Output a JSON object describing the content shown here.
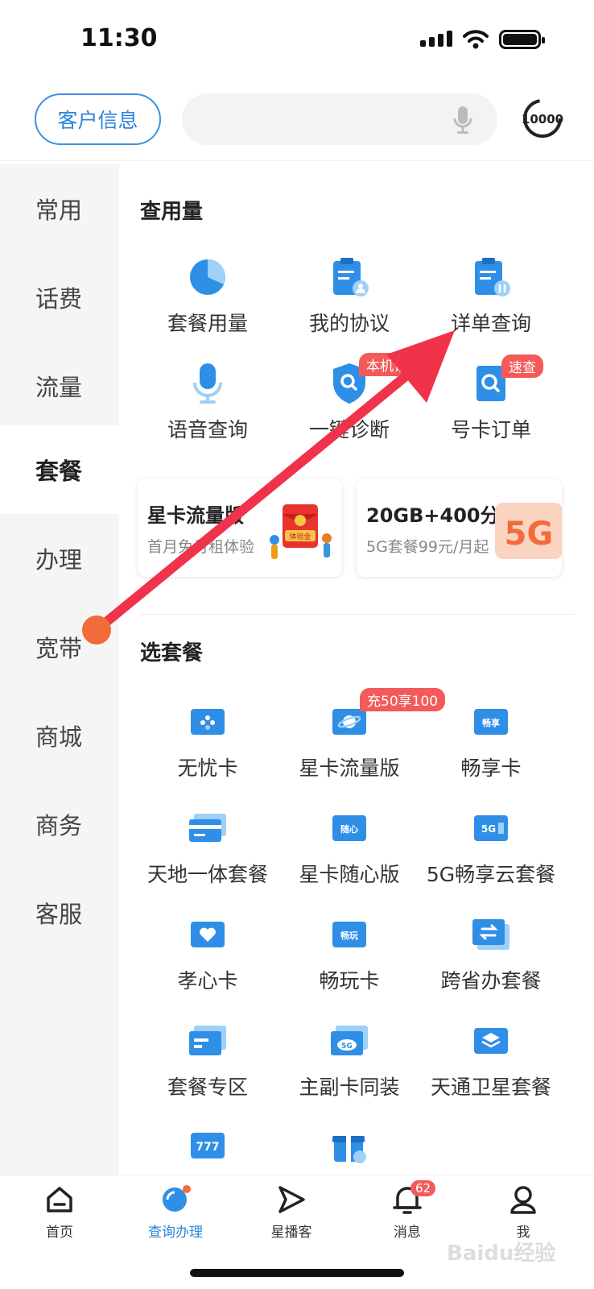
{
  "status": {
    "time": "11:30"
  },
  "header": {
    "customer_info_label": "客户信息",
    "search_placeholder": "",
    "hotline_label": "10000"
  },
  "sidebar": {
    "items": [
      {
        "label": "常用"
      },
      {
        "label": "话费"
      },
      {
        "label": "流量"
      },
      {
        "label": "套餐",
        "active": true
      },
      {
        "label": "办理"
      },
      {
        "label": "宽带"
      },
      {
        "label": "商城"
      },
      {
        "label": "商务"
      },
      {
        "label": "客服"
      }
    ]
  },
  "usage": {
    "title": "查用量",
    "items": [
      {
        "label": "套餐用量",
        "icon": "pie-chart-icon"
      },
      {
        "label": "我的协议",
        "icon": "agreement-icon"
      },
      {
        "label": "详单查询",
        "icon": "bill-detail-icon"
      },
      {
        "label": "语音查询",
        "icon": "microphone-icon"
      },
      {
        "label": "一键诊断",
        "icon": "shield-search-icon",
        "tag": "本机诊"
      },
      {
        "label": "号卡订单",
        "icon": "order-search-icon",
        "tag": "速查"
      }
    ]
  },
  "promos": [
    {
      "title": "星卡流量版",
      "subtitle": "首月免月租体验",
      "badge_text": "体验金"
    },
    {
      "title": "20GB+400分钟",
      "subtitle": "5G套餐99元/月起",
      "badge_text": "5G"
    }
  ],
  "plans": {
    "title": "选套餐",
    "items": [
      {
        "label": "无忧卡",
        "icon": "sim-card-icon"
      },
      {
        "label": "星卡流量版",
        "icon": "planet-card-icon",
        "tag": "充50享100"
      },
      {
        "label": "畅享卡",
        "icon": "changxiang-card-icon",
        "icon_text": "畅享"
      },
      {
        "label": "天地一体套餐",
        "icon": "stacked-cards-icon"
      },
      {
        "label": "星卡随心版",
        "icon": "suixin-card-icon",
        "icon_text": "随心"
      },
      {
        "label": "5G畅享云套餐",
        "icon": "5g-cloud-card-icon",
        "icon_text": "5G"
      },
      {
        "label": "孝心卡",
        "icon": "heart-card-icon"
      },
      {
        "label": "畅玩卡",
        "icon": "changwan-card-icon",
        "icon_text": "畅玩"
      },
      {
        "label": "跨省办套餐",
        "icon": "transfer-card-icon"
      },
      {
        "label": "套餐专区",
        "icon": "cards-zone-icon"
      },
      {
        "label": "主副卡同装",
        "icon": "cloud-card-icon",
        "icon_text": "5G"
      },
      {
        "label": "天通卫星套餐",
        "icon": "layers-card-icon"
      },
      {
        "label": "",
        "icon": "777-card-icon",
        "icon_text": "777"
      },
      {
        "label": "",
        "icon": "gift-icon"
      }
    ]
  },
  "tabbar": {
    "items": [
      {
        "label": "首页",
        "icon": "home-icon"
      },
      {
        "label": "查询办理",
        "icon": "query-icon",
        "active": true
      },
      {
        "label": "星播客",
        "icon": "play-send-icon"
      },
      {
        "label": "消息",
        "icon": "bell-icon",
        "badge": "62"
      },
      {
        "label": "我",
        "icon": "user-icon"
      }
    ]
  },
  "watermark": "Baidu经验",
  "colors": {
    "primary": "#2c83da",
    "accent_red": "#f45a5a",
    "annotation_arrow": "#f0334a"
  }
}
